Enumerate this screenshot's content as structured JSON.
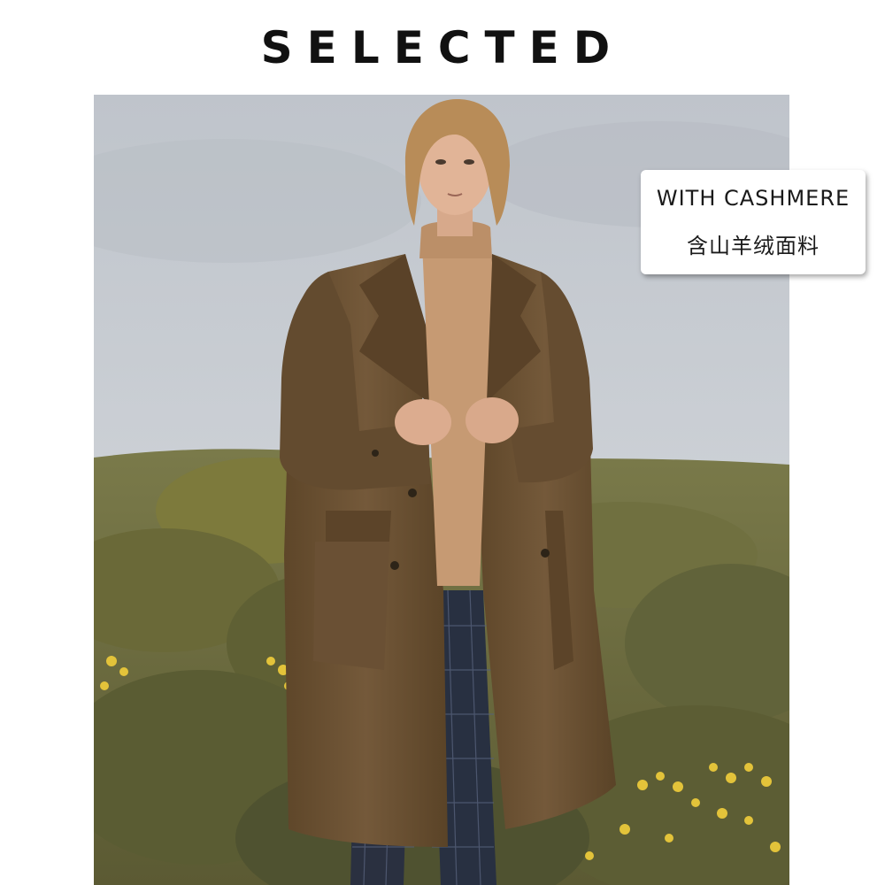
{
  "brand": {
    "name": "SELECTED"
  },
  "photo": {
    "subject": "model-in-brown-wool-overcoat",
    "colors": {
      "sky": "#c4c9cf",
      "coat": "#6e5436",
      "sweater": "#c69a73",
      "trousers": "#2a3040",
      "foliage": "#6b6a3a",
      "flowers": "#e3c33a"
    }
  },
  "badge": {
    "line1": "WITH CASHMERE",
    "line2": "含山羊绒面料"
  }
}
